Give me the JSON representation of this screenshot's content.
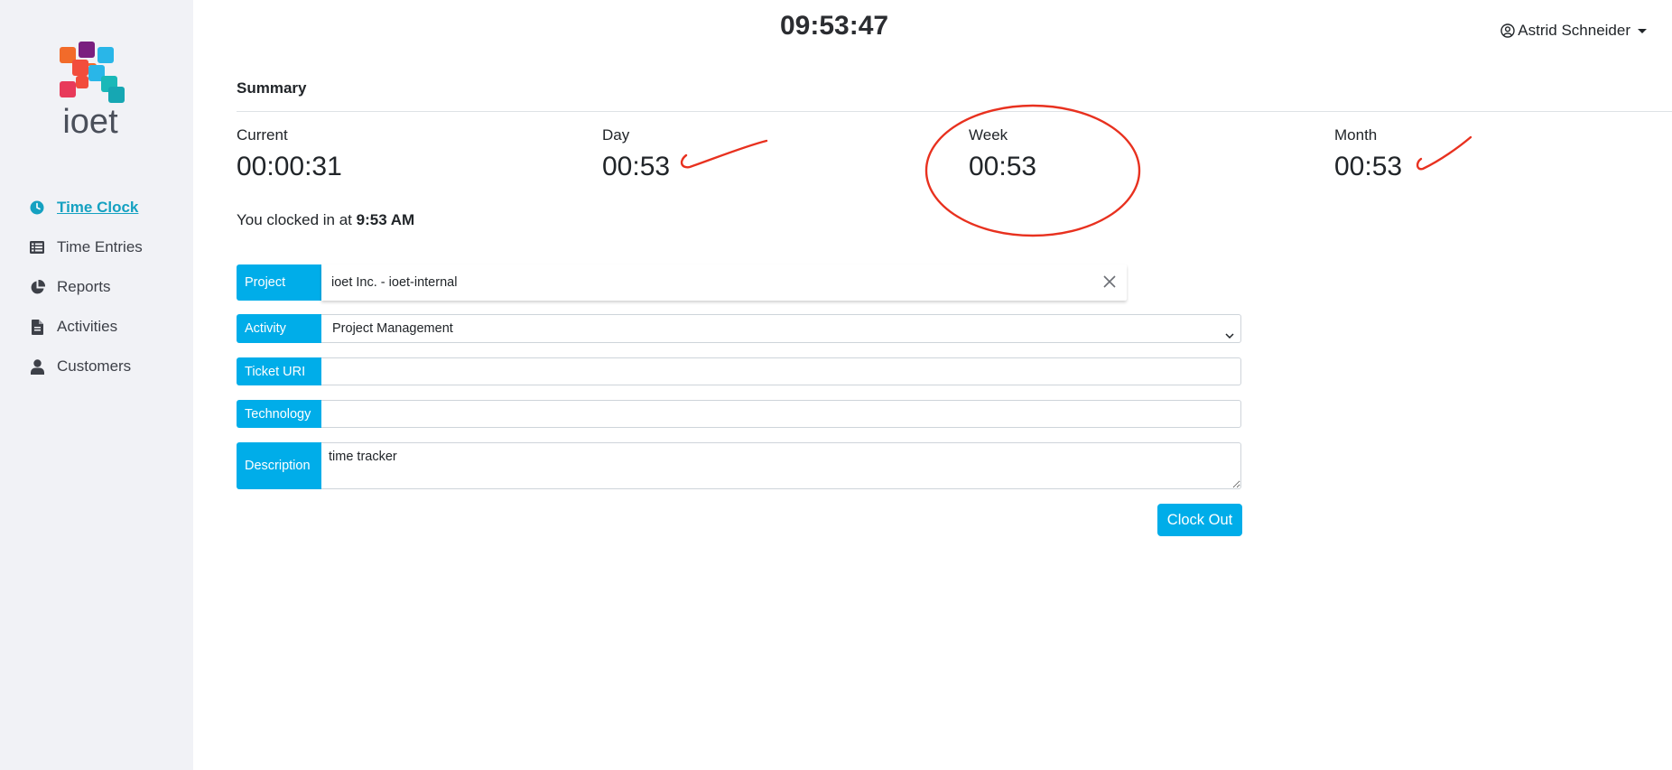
{
  "brand": {
    "name": "ioet"
  },
  "sidebar": {
    "items": [
      {
        "label": "Time Clock",
        "icon": "clock-icon",
        "active": true
      },
      {
        "label": "Time Entries",
        "icon": "list-icon",
        "active": false
      },
      {
        "label": "Reports",
        "icon": "pie-chart-icon",
        "active": false
      },
      {
        "label": "Activities",
        "icon": "file-icon",
        "active": false
      },
      {
        "label": "Customers",
        "icon": "user-icon",
        "active": false
      }
    ]
  },
  "header": {
    "clock": "09:53:47",
    "user_name": "Astrid Schneider"
  },
  "summary": {
    "title": "Summary",
    "stats": [
      {
        "label": "Current",
        "value": "00:00:31"
      },
      {
        "label": "Day",
        "value": "00:53"
      },
      {
        "label": "Week",
        "value": "00:53"
      },
      {
        "label": "Month",
        "value": "00:53"
      }
    ]
  },
  "clock_in": {
    "prefix": "You clocked in at ",
    "time": "9:53 AM"
  },
  "form": {
    "project": {
      "label": "Project",
      "value": "ioet Inc. - ioet-internal"
    },
    "activity": {
      "label": "Activity",
      "value": "Project Management"
    },
    "ticket": {
      "label": "Ticket URI",
      "value": ""
    },
    "technology": {
      "label": "Technology",
      "value": ""
    },
    "description": {
      "label": "Description",
      "value": "time tracker"
    },
    "clock_out_label": "Clock Out"
  },
  "colors": {
    "accent": "#00ade9",
    "active_nav": "#15a1c1",
    "annotation": "#e8311f",
    "sidebar_bg": "#f1f2f6"
  }
}
